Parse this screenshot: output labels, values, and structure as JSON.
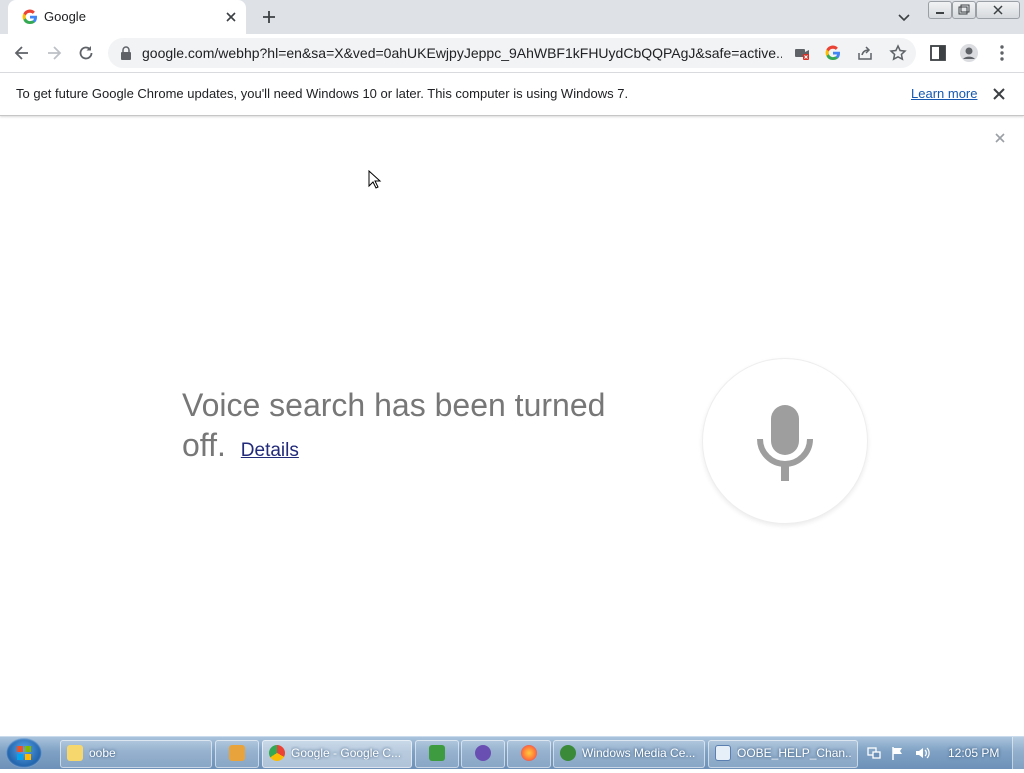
{
  "browser": {
    "tab": {
      "title": "Google",
      "favicon": "google-g-icon"
    },
    "url": "google.com/webhp?hl=en&sa=X&ved=0ahUKEwjpyJeppc_9AhWBF1kFHUydCbQQPAgJ&safe=active...",
    "infobar": {
      "message": "To get future Google Chrome updates, you'll need Windows 10 or later. This computer is using Windows 7.",
      "link": "Learn more"
    }
  },
  "page": {
    "voice_message": "Voice search has been turned off.",
    "voice_message_line1": "Voice search has been turned",
    "voice_message_line2": "off.",
    "details_link": "Details"
  },
  "taskbar": {
    "items": [
      {
        "label": "oobe",
        "icon": "folder-icon"
      },
      {
        "label": "",
        "icon": "media-player-icon"
      },
      {
        "label": "Google - Google C...",
        "icon": "chrome-icon",
        "active": true
      },
      {
        "label": "",
        "icon": "app-icon"
      },
      {
        "label": "",
        "icon": "obs-icon"
      },
      {
        "label": "",
        "icon": "firefox-icon"
      },
      {
        "label": "Windows Media Ce...",
        "icon": "media-center-icon"
      },
      {
        "label": "OOBE_HELP_Chan...",
        "icon": "document-icon"
      }
    ],
    "clock": "12:05 PM"
  },
  "colors": {
    "tabstrip": "#dee1e6",
    "link": "#1558b0",
    "voice_text": "#777777",
    "mic": "#9e9e9e"
  }
}
